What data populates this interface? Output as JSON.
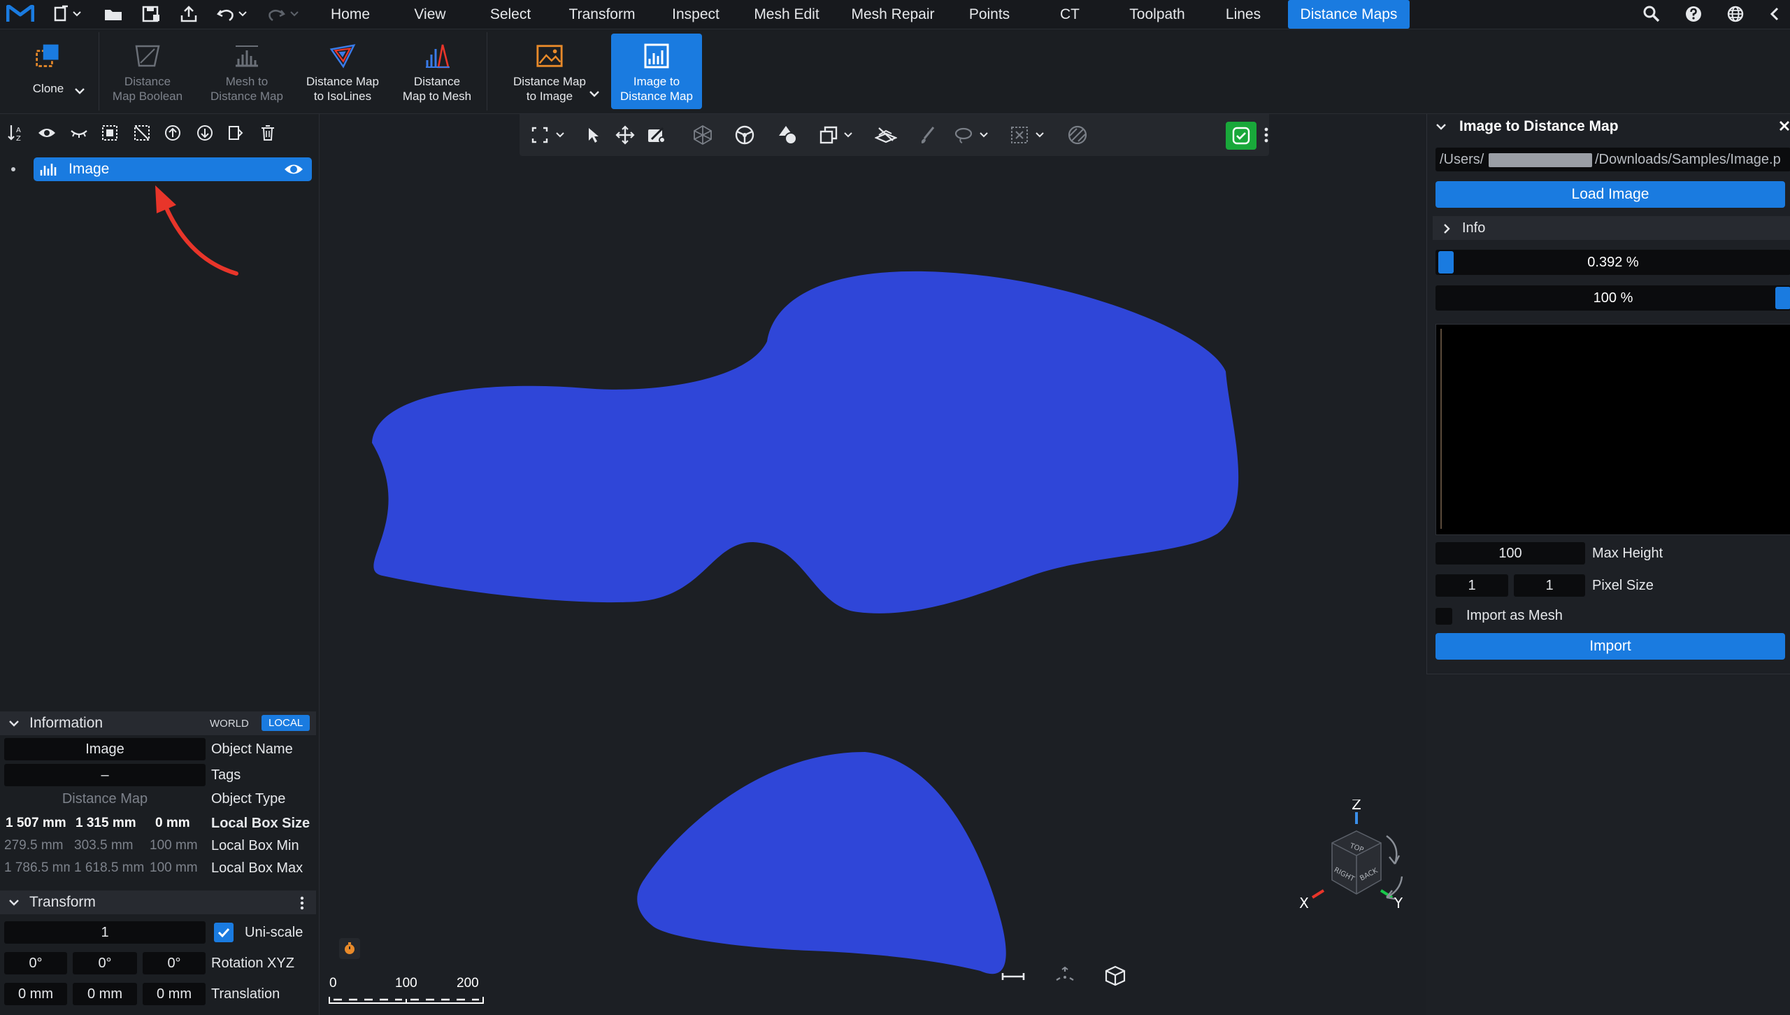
{
  "menu": {
    "tabs": [
      "Home",
      "View",
      "Select",
      "Transform",
      "Inspect",
      "Mesh Edit",
      "Mesh Repair",
      "Points",
      "CT",
      "Toolpath",
      "Lines",
      "Distance Maps"
    ],
    "active_tab": "Distance Maps"
  },
  "ribbon": {
    "clone": "Clone",
    "distance_map_boolean": "Distance\nMap Boolean",
    "mesh_to_distance_map": "Mesh to\nDistance Map",
    "distance_map_to_isolines": "Distance Map\nto IsoLines",
    "distance_map_to_mesh": "Distance\nMap to Mesh",
    "distance_map_to_image": "Distance Map\nto Image",
    "image_to_distance_map": "Image to\nDistance Map"
  },
  "scene_tree": {
    "item_label": "Image"
  },
  "information": {
    "title": "Information",
    "world": "WORLD",
    "local": "LOCAL",
    "object_name_value": "Image",
    "object_name_label": "Object Name",
    "tags_value": "–",
    "tags_label": "Tags",
    "object_type_value": "Distance Map",
    "object_type_label": "Object Type",
    "box_size": [
      "1 507 mm",
      "1 315 mm",
      "0 mm"
    ],
    "box_size_label": "Local Box Size",
    "box_min": [
      "279.5 mm",
      "303.5 mm",
      "100 mm"
    ],
    "box_min_label": "Local Box Min",
    "box_max": [
      "1 786.5 mm",
      "1 618.5 mm",
      "100 mm"
    ],
    "box_max_label": "Local Box Max"
  },
  "transform": {
    "title": "Transform",
    "scale_value": "1",
    "uniscale_label": "Uni-scale",
    "uniscale_checked": true,
    "rotation": [
      "0°",
      "0°",
      "0°"
    ],
    "rotation_label": "Rotation XYZ",
    "translation": [
      "0 mm",
      "0 mm",
      "0 mm"
    ],
    "translation_label": "Translation"
  },
  "scale_bar": {
    "ticks": [
      "0",
      "100",
      "200"
    ]
  },
  "axes": {
    "z": "Z",
    "x": "X",
    "y": "Y",
    "cube_top": "TOP",
    "cube_right": "RIGHT",
    "cube_back": "BACK"
  },
  "tool_panel": {
    "title": "Image to Distance Map",
    "path_prefix": "/Users/",
    "path_suffix": "/Downloads/Samples/Image.p",
    "load_button": "Load Image",
    "info_label": "Info",
    "slider1": "0.392 %",
    "slider1_fraction": 0.0039,
    "slider2": "100 %",
    "slider2_fraction": 1.0,
    "max_height_value": "100",
    "max_height_label": "Max Height",
    "pixel_size_x": "1",
    "pixel_size_y": "1",
    "pixel_size_label": "Pixel Size",
    "import_as_mesh_label": "Import as Mesh",
    "import_as_mesh_checked": false,
    "import_button": "Import"
  },
  "colors": {
    "accent": "#1a7be0",
    "shape_fill": "#2f46d8",
    "annotation_arrow": "#e8352a",
    "toggle_green": "#19a83a",
    "ribbon_orange": "#e88a2a"
  }
}
